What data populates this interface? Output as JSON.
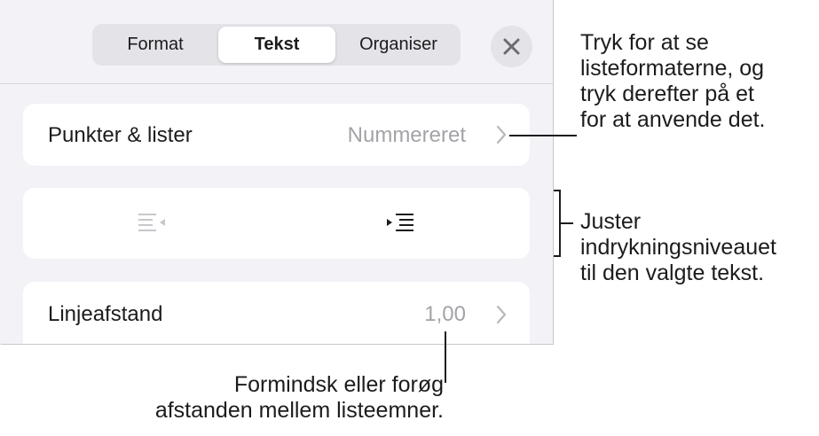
{
  "tabs": [
    {
      "label": "Format",
      "active": false
    },
    {
      "label": "Tekst",
      "active": true
    },
    {
      "label": "Organiser",
      "active": false
    }
  ],
  "close_icon": "close-icon",
  "bullets_row": {
    "label": "Punkter & lister",
    "value": "Nummereret",
    "icon": "chevron-right-icon"
  },
  "indent_row": {
    "outdent_icon": "decrease-indent-icon",
    "indent_icon": "increase-indent-icon"
  },
  "spacing_row": {
    "label": "Linjeafstand",
    "value": "1,00",
    "icon": "chevron-right-icon"
  },
  "callouts": {
    "bullets": [
      "Tryk for at se",
      "listeformaterne, og",
      "tryk derefter på et",
      "for at anvende det."
    ],
    "indent": [
      "Juster",
      "indrykningsniveauet",
      "til den valgte tekst."
    ],
    "spacing": [
      "Formindsk eller forøg",
      "afstanden mellem listeemner."
    ]
  },
  "colors": {
    "panel_bg": "#f2f2f7",
    "row_bg": "#ffffff",
    "secondary_text": "#a3a3a8",
    "segment_bg": "#e3e3e8",
    "disabled_icon": "#c7c7cc"
  }
}
